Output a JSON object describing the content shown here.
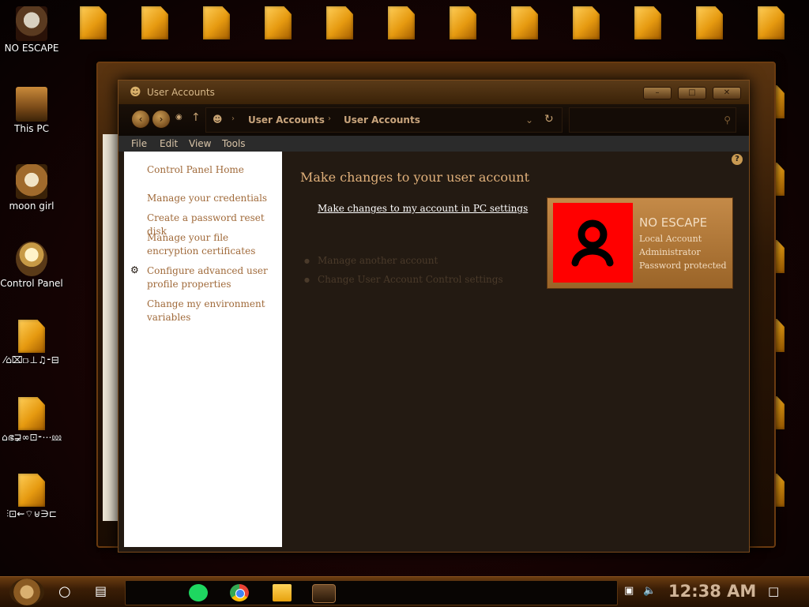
{
  "desktop": {
    "left_icons": [
      {
        "label": "NO ESCAPE",
        "art": "skull"
      },
      {
        "label": "This PC",
        "art": "pc"
      },
      {
        "label": "moon girl",
        "art": "girl"
      },
      {
        "label": "Control Panel",
        "art": "bulb"
      }
    ],
    "left_lower_labels": [
      "⁄⌂⌧⟥⊥♫⁃⊟",
      "⌂ഭ⋥∞⊡⁃⋯⅏",
      "⫶⊡⇜⌔⊎∋⊏",
      "⁄⊴⊢⁄⊡⊞"
    ]
  },
  "window": {
    "title": "User Accounts",
    "menu": [
      "File",
      "Edit",
      "View",
      "Tools"
    ],
    "breadcrumbs": [
      "User Accounts",
      "User Accounts"
    ],
    "left_panel": {
      "home": "Control Panel Home",
      "links": [
        "Manage your credentials",
        "Create a password reset disk",
        "Manage your file encryption certificates",
        "Configure advanced user profile properties",
        "Change my environment variables"
      ]
    },
    "content": {
      "heading": "Make changes to your user account",
      "pc_settings_link": "Make changes to my account in PC settings",
      "dim_links": [
        "Manage another account",
        "Change User Account Control settings"
      ],
      "card": {
        "name": "NO ESCAPE",
        "lines": [
          "Local Account",
          "Administrator",
          "Password protected"
        ],
        "avatar_bg": "#ff0000"
      }
    }
  },
  "taskbar": {
    "clock": "12:38 AM"
  }
}
